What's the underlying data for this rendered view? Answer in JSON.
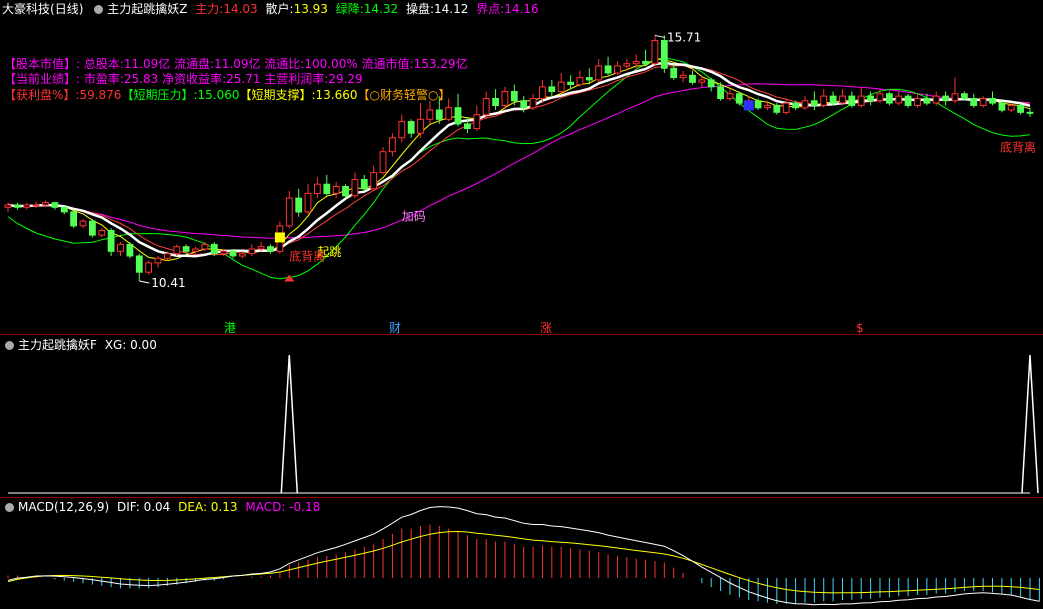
{
  "main_header": {
    "stock": "大豪科技",
    "period": "(日线)",
    "indicator": "主力起跳擒妖Z",
    "zhuli_label": "主力:",
    "zhuli_val": "14.03",
    "sanhu_label": "散户:",
    "sanhu_val": "13.93",
    "lvjiang_label": "绿降:",
    "lvjiang_val": "14.32",
    "caopan_label": "操盘:",
    "caopan_val": "14.12",
    "jiedian_label": "界点:",
    "jiedian_val": "14.16"
  },
  "info": {
    "row1_tag": "【股本市值】:",
    "row1_text": "总股本:11.09亿 流通盘:11.09亿 流通比:100.00% 流通市值:153.29亿",
    "row2_tag": "【当前业绩】:",
    "row2_text": "市盈率:25.83 净资收益率:25.71 主营利润率:29.29",
    "row3_a": "【获利盘%】:59.876",
    "row3_b": "【短期压力】:15.060",
    "row3_c": "【短期支撑】:13.660",
    "row3_d": "【○财务轻警○】"
  },
  "annotations": {
    "high": "15.71",
    "low": "10.41",
    "jiama": "加码",
    "qitiao": "起跳",
    "dixiang_left": "底背离",
    "dixiang_right": "底背离"
  },
  "events": {
    "gang": "港",
    "cai": "财",
    "zhang": "涨",
    "s": "$"
  },
  "xg_header": {
    "title": "主力起跳擒妖F",
    "xg": "XG: 0.00"
  },
  "macd_header": {
    "title": "MACD(12,26,9)",
    "dif": "DIF: 0.04",
    "dea": "DEA: 0.13",
    "macd": "MACD: -0.18"
  },
  "colors": {
    "up": "#ff3232",
    "down": "#54ff54",
    "ma_white": "#ffffff",
    "ma_yellow": "#ffff00",
    "ma_magenta": "#ff00ff",
    "ma_green": "#00ff00",
    "dea": "#ffff00"
  },
  "chart_data": {
    "type": "candlestick",
    "price_range": [
      10.0,
      16.0
    ],
    "candles": [
      [
        12.0,
        12.05,
        11.9,
        12.1
      ],
      [
        12.05,
        12.0,
        11.95,
        12.1
      ],
      [
        12.0,
        12.05,
        11.95,
        12.1
      ],
      [
        12.05,
        12.05,
        11.98,
        12.12
      ],
      [
        12.05,
        12.1,
        12.0,
        12.15
      ],
      [
        12.1,
        12.0,
        11.95,
        12.12
      ],
      [
        12.0,
        11.9,
        11.85,
        12.02
      ],
      [
        11.9,
        11.6,
        11.55,
        11.95
      ],
      [
        11.6,
        11.7,
        11.55,
        11.75
      ],
      [
        11.7,
        11.4,
        11.35,
        11.75
      ],
      [
        11.4,
        11.5,
        11.35,
        11.55
      ],
      [
        11.5,
        11.05,
        10.95,
        11.55
      ],
      [
        11.05,
        11.2,
        10.95,
        11.25
      ],
      [
        11.2,
        10.95,
        10.9,
        11.25
      ],
      [
        10.95,
        10.6,
        10.41,
        11.0
      ],
      [
        10.6,
        10.8,
        10.55,
        10.85
      ],
      [
        10.8,
        10.9,
        10.7,
        10.95
      ],
      [
        10.9,
        11.0,
        10.85,
        11.05
      ],
      [
        11.0,
        11.15,
        10.95,
        11.2
      ],
      [
        11.15,
        11.05,
        11.0,
        11.2
      ],
      [
        11.05,
        11.1,
        11.0,
        11.15
      ],
      [
        11.1,
        11.2,
        11.05,
        11.25
      ],
      [
        11.2,
        11.0,
        10.95,
        11.25
      ],
      [
        11.0,
        11.05,
        10.95,
        11.1
      ],
      [
        11.05,
        10.95,
        10.9,
        11.1
      ],
      [
        10.95,
        11.0,
        10.9,
        11.05
      ],
      [
        11.0,
        11.1,
        10.95,
        11.2
      ],
      [
        11.1,
        11.15,
        11.05,
        11.25
      ],
      [
        11.15,
        11.05,
        11.0,
        11.2
      ],
      [
        11.05,
        11.6,
        11.0,
        11.7
      ],
      [
        11.6,
        12.2,
        11.55,
        12.35
      ],
      [
        12.2,
        11.9,
        11.8,
        12.4
      ],
      [
        11.9,
        12.3,
        11.85,
        12.5
      ],
      [
        12.3,
        12.5,
        12.2,
        12.65
      ],
      [
        12.5,
        12.3,
        12.25,
        12.7
      ],
      [
        12.3,
        12.45,
        12.2,
        12.55
      ],
      [
        12.45,
        12.25,
        12.2,
        12.5
      ],
      [
        12.25,
        12.6,
        12.2,
        12.75
      ],
      [
        12.6,
        12.4,
        12.35,
        12.7
      ],
      [
        12.4,
        12.75,
        12.35,
        12.9
      ],
      [
        12.75,
        13.2,
        12.7,
        13.3
      ],
      [
        13.2,
        13.5,
        13.1,
        13.6
      ],
      [
        13.5,
        13.85,
        13.4,
        14.0
      ],
      [
        13.85,
        13.6,
        13.5,
        13.9
      ],
      [
        13.6,
        13.9,
        13.5,
        14.25
      ],
      [
        13.9,
        14.1,
        13.8,
        14.3
      ],
      [
        14.1,
        13.9,
        13.8,
        14.4
      ],
      [
        13.9,
        14.15,
        13.85,
        14.35
      ],
      [
        14.15,
        13.8,
        13.75,
        14.45
      ],
      [
        13.8,
        13.7,
        13.6,
        13.95
      ],
      [
        13.7,
        14.0,
        13.65,
        14.2
      ],
      [
        14.0,
        14.35,
        13.9,
        14.5
      ],
      [
        14.35,
        14.2,
        14.1,
        14.55
      ],
      [
        14.2,
        14.5,
        14.1,
        14.6
      ],
      [
        14.5,
        14.3,
        14.2,
        14.65
      ],
      [
        14.3,
        14.15,
        14.05,
        14.4
      ],
      [
        14.15,
        14.35,
        14.1,
        14.45
      ],
      [
        14.35,
        14.6,
        14.25,
        14.75
      ],
      [
        14.6,
        14.5,
        14.4,
        14.75
      ],
      [
        14.5,
        14.7,
        14.45,
        14.9
      ],
      [
        14.7,
        14.65,
        14.55,
        14.85
      ],
      [
        14.65,
        14.8,
        14.6,
        14.95
      ],
      [
        14.8,
        14.75,
        14.65,
        15.0
      ],
      [
        14.75,
        15.05,
        14.7,
        15.2
      ],
      [
        15.05,
        14.9,
        14.85,
        15.25
      ],
      [
        14.9,
        15.05,
        14.85,
        15.15
      ],
      [
        15.05,
        15.1,
        14.95,
        15.2
      ],
      [
        15.1,
        15.15,
        15.0,
        15.3
      ],
      [
        15.15,
        15.1,
        15.05,
        15.4
      ],
      [
        15.1,
        15.6,
        15.05,
        15.71
      ],
      [
        15.6,
        15.0,
        14.9,
        15.71
      ],
      [
        15.0,
        14.8,
        14.75,
        15.1
      ],
      [
        14.8,
        14.85,
        14.7,
        14.95
      ],
      [
        14.85,
        14.7,
        14.65,
        14.95
      ],
      [
        14.7,
        14.75,
        14.6,
        14.85
      ],
      [
        14.75,
        14.6,
        14.5,
        14.8
      ],
      [
        14.6,
        14.35,
        14.3,
        14.7
      ],
      [
        14.35,
        14.45,
        14.3,
        14.55
      ],
      [
        14.45,
        14.25,
        14.2,
        14.5
      ],
      [
        14.25,
        14.3,
        14.2,
        14.4
      ],
      [
        14.3,
        14.15,
        14.1,
        14.35
      ],
      [
        14.15,
        14.2,
        14.1,
        14.3
      ],
      [
        14.2,
        14.05,
        14.0,
        14.25
      ],
      [
        14.05,
        14.25,
        14.0,
        14.35
      ],
      [
        14.25,
        14.15,
        14.1,
        14.3
      ],
      [
        14.15,
        14.3,
        14.1,
        14.4
      ],
      [
        14.3,
        14.2,
        14.1,
        14.5
      ],
      [
        14.2,
        14.4,
        14.15,
        14.55
      ],
      [
        14.4,
        14.25,
        14.2,
        14.5
      ],
      [
        14.25,
        14.4,
        14.2,
        14.55
      ],
      [
        14.4,
        14.2,
        14.15,
        14.5
      ],
      [
        14.2,
        14.4,
        14.15,
        14.6
      ],
      [
        14.4,
        14.3,
        14.2,
        14.5
      ],
      [
        14.3,
        14.45,
        14.25,
        14.55
      ],
      [
        14.45,
        14.25,
        14.2,
        14.5
      ],
      [
        14.25,
        14.4,
        14.2,
        14.5
      ],
      [
        14.4,
        14.2,
        14.15,
        14.45
      ],
      [
        14.2,
        14.35,
        14.15,
        14.45
      ],
      [
        14.35,
        14.25,
        14.2,
        14.45
      ],
      [
        14.25,
        14.4,
        14.2,
        14.5
      ],
      [
        14.4,
        14.3,
        14.2,
        14.5
      ],
      [
        14.3,
        14.45,
        14.25,
        14.8
      ],
      [
        14.45,
        14.35,
        14.3,
        14.5
      ],
      [
        14.35,
        14.2,
        14.15,
        14.45
      ],
      [
        14.2,
        14.35,
        14.15,
        14.4
      ],
      [
        14.35,
        14.25,
        14.2,
        14.5
      ],
      [
        14.25,
        14.1,
        14.05,
        14.3
      ],
      [
        14.1,
        14.2,
        14.05,
        14.25
      ],
      [
        14.2,
        14.05,
        14.0,
        14.25
      ],
      [
        14.05,
        14.03,
        13.95,
        14.15
      ]
    ],
    "xg_spikes": [
      30,
      109
    ],
    "macd_bars": [
      0.02,
      0.02,
      0.01,
      0.01,
      0.0,
      -0.01,
      -0.02,
      -0.03,
      -0.04,
      -0.05,
      -0.06,
      -0.07,
      -0.08,
      -0.08,
      -0.08,
      -0.08,
      -0.07,
      -0.06,
      -0.05,
      -0.04,
      -0.03,
      -0.02,
      -0.02,
      -0.01,
      0.0,
      0.0,
      0.01,
      0.01,
      0.02,
      0.05,
      0.1,
      0.12,
      0.14,
      0.16,
      0.17,
      0.18,
      0.2,
      0.22,
      0.24,
      0.26,
      0.3,
      0.34,
      0.38,
      0.38,
      0.4,
      0.41,
      0.4,
      0.38,
      0.36,
      0.33,
      0.3,
      0.3,
      0.28,
      0.28,
      0.26,
      0.24,
      0.24,
      0.25,
      0.24,
      0.24,
      0.23,
      0.22,
      0.21,
      0.2,
      0.18,
      0.17,
      0.16,
      0.15,
      0.14,
      0.13,
      0.12,
      0.08,
      0.04,
      0.0,
      -0.04,
      -0.07,
      -0.1,
      -0.13,
      -0.15,
      -0.17,
      -0.18,
      -0.19,
      -0.2,
      -0.2,
      -0.2,
      -0.19,
      -0.19,
      -0.18,
      -0.18,
      -0.17,
      -0.17,
      -0.16,
      -0.16,
      -0.15,
      -0.15,
      -0.14,
      -0.14,
      -0.13,
      -0.13,
      -0.12,
      -0.12,
      -0.11,
      -0.1,
      -0.1,
      -0.1,
      -0.11,
      -0.12,
      -0.13,
      -0.15,
      -0.17,
      -0.18
    ]
  }
}
